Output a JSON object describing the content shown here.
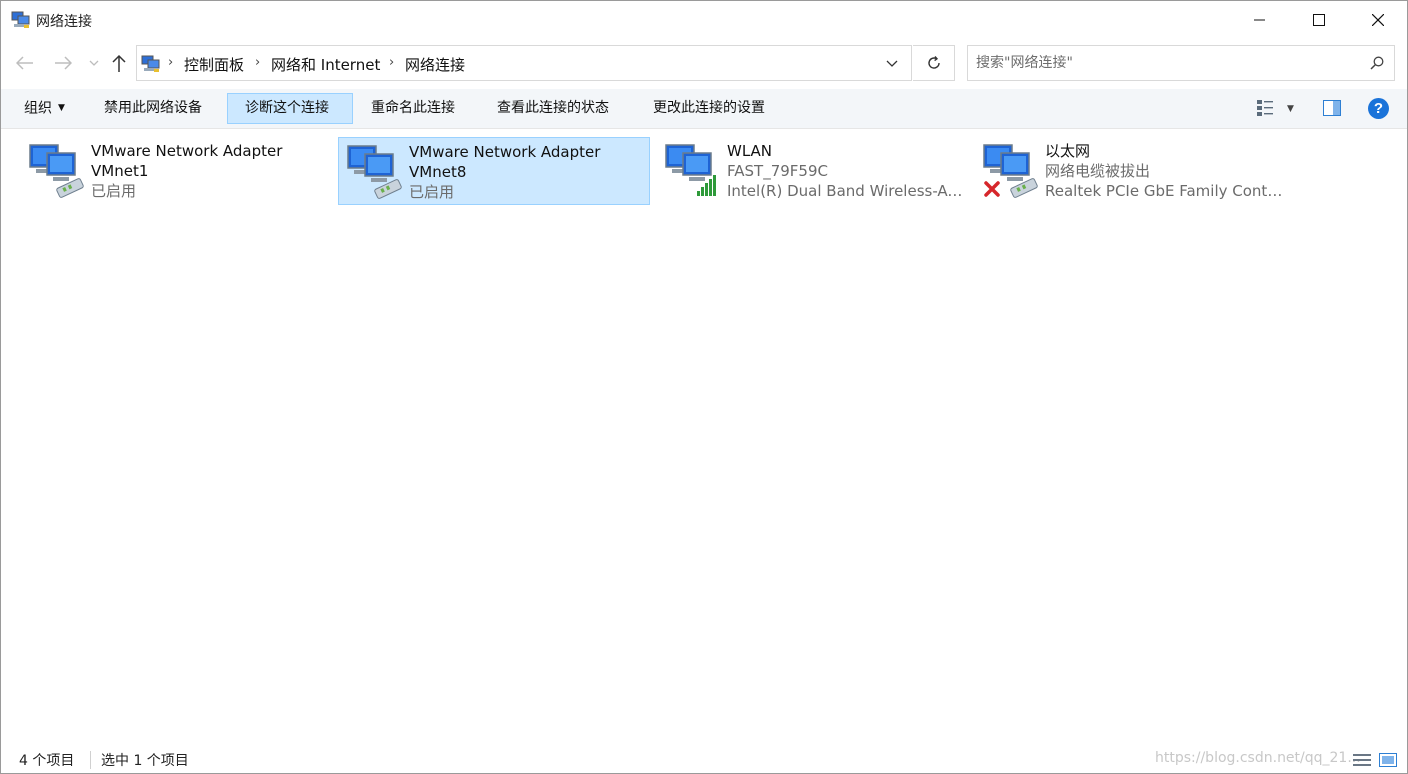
{
  "window": {
    "title": "网络连接"
  },
  "address": {
    "breadcrumbs": [
      "控制面板",
      "网络和 Internet",
      "网络连接"
    ]
  },
  "search": {
    "placeholder": "搜索\"网络连接\""
  },
  "commands": {
    "organize": "组织",
    "disable": "禁用此网络设备",
    "diagnose": "诊断这个连接",
    "rename": "重命名此连接",
    "status": "查看此连接的状态",
    "settings": "更改此连接的设置"
  },
  "connections": [
    {
      "name": "VMware Network Adapter",
      "name2": "VMnet1",
      "status": "已启用",
      "icon": "network-adapter-icon",
      "selected": false
    },
    {
      "name": "VMware Network Adapter",
      "name2": "VMnet8",
      "status": "已启用",
      "icon": "network-adapter-icon",
      "selected": true
    },
    {
      "name": "WLAN",
      "ssid": "FAST_79F59C",
      "device": "Intel(R) Dual Band Wireless-AC...",
      "icon": "wifi-adapter-icon",
      "selected": false
    },
    {
      "name": "以太网",
      "status": "网络电缆被拔出",
      "device": "Realtek PCIe GbE Family Contr...",
      "icon": "ethernet-disconnected-icon",
      "selected": false
    }
  ],
  "statusbar": {
    "count": "4 个项目",
    "selected": "选中 1 个项目",
    "watermark": "https://blog.csdn.net/qq_21..."
  },
  "colors": {
    "selection_bg": "#cce8ff",
    "selection_border": "#99d1ff",
    "commandbar_bg": "#f3f6f9",
    "help_blue": "#1a73d9"
  }
}
